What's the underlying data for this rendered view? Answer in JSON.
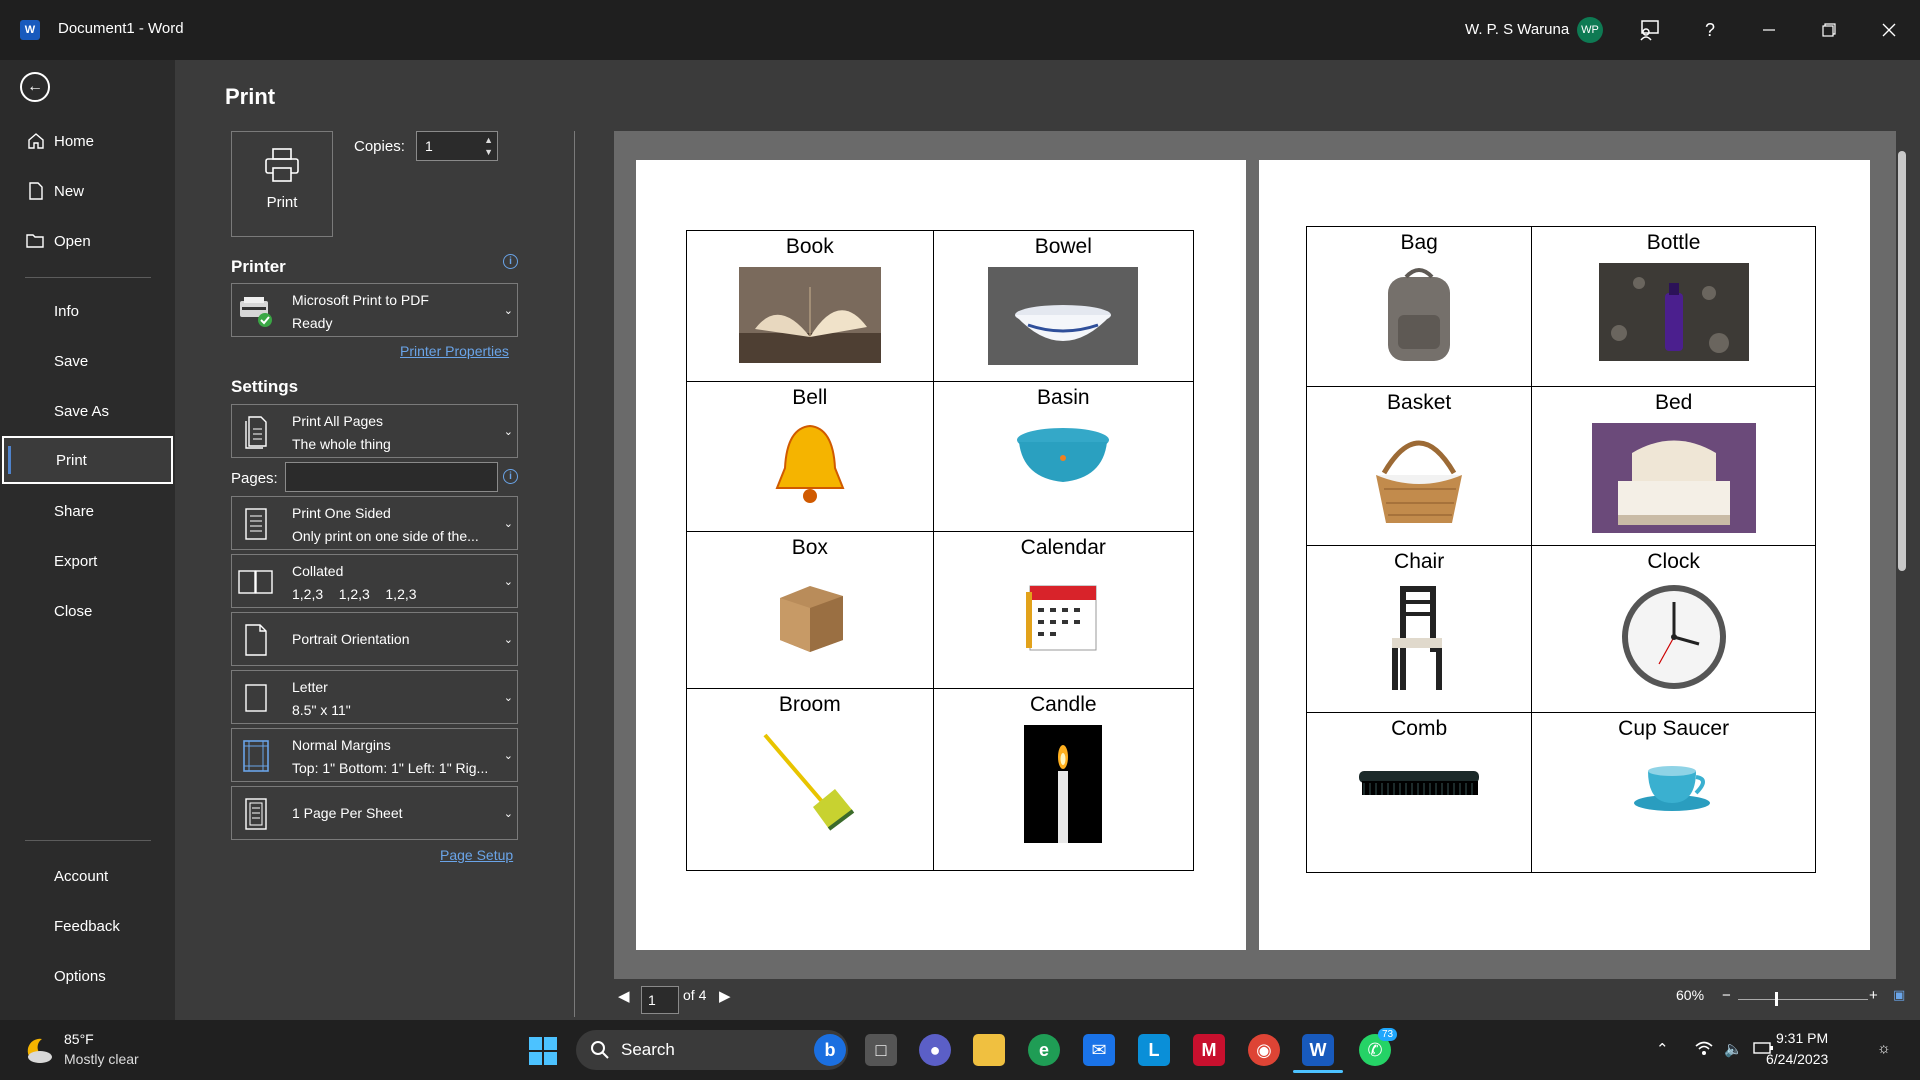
{
  "titlebar": {
    "app_icon": "word-icon",
    "document_title": "Document1  -  Word",
    "user_name": "W. P. S Waruna",
    "user_initials": "WP"
  },
  "nav": {
    "items": [
      {
        "label": "Home",
        "icon": "home-icon"
      },
      {
        "label": "New",
        "icon": "new-document-icon"
      },
      {
        "label": "Open",
        "icon": "open-folder-icon"
      },
      {
        "label": "Info"
      },
      {
        "label": "Save"
      },
      {
        "label": "Save As"
      },
      {
        "label": "Print",
        "selected": true
      },
      {
        "label": "Share"
      },
      {
        "label": "Export"
      },
      {
        "label": "Close"
      }
    ],
    "bottom_items": [
      {
        "label": "Account"
      },
      {
        "label": "Feedback"
      },
      {
        "label": "Options"
      }
    ]
  },
  "print": {
    "heading": "Print",
    "button_label": "Print",
    "copies_label": "Copies:",
    "copies_value": "1",
    "printer_heading": "Printer",
    "printer_name": "Microsoft Print to PDF",
    "printer_status": "Ready",
    "printer_properties": "Printer Properties",
    "settings_heading": "Settings",
    "pages_label": "Pages:",
    "pages_value": "",
    "settings": [
      {
        "line1": "Print All Pages",
        "line2": "The whole thing",
        "icon": "pages-icon"
      },
      {
        "line1": "Print One Sided",
        "line2": "Only print on one side of the...",
        "icon": "one-sided-icon"
      },
      {
        "line1": "Collated",
        "line2": "1,2,3    1,2,3    1,2,3",
        "icon": "collated-icon"
      },
      {
        "line1": "Portrait Orientation",
        "line2": "",
        "icon": "portrait-icon"
      },
      {
        "line1": "Letter",
        "line2": "8.5\" x 11\"",
        "icon": "paper-size-icon"
      },
      {
        "line1": "Normal Margins",
        "line2": "Top: 1\" Bottom: 1\" Left: 1\" Rig...",
        "icon": "margins-icon"
      },
      {
        "line1": "1 Page Per Sheet",
        "line2": "",
        "icon": "pages-per-sheet-icon"
      }
    ],
    "page_setup": "Page Setup"
  },
  "preview": {
    "page1": [
      [
        "Book",
        "Bowel"
      ],
      [
        "Bell",
        "Basin"
      ],
      [
        "Box",
        "Calendar"
      ],
      [
        "Broom",
        "Candle"
      ]
    ],
    "page2": [
      [
        "Bag",
        "Bottle"
      ],
      [
        "Basket",
        "Bed"
      ],
      [
        "Chair",
        "Clock"
      ],
      [
        "Comb",
        "Cup Saucer"
      ]
    ],
    "current_page": "1",
    "total_pages": "of 4",
    "zoom": "60%"
  },
  "taskbar": {
    "weather_temp": "85°F",
    "weather_desc": "Mostly clear",
    "search_placeholder": "Search",
    "whatsapp_badge": "73",
    "time": "9:31 PM",
    "date": "6/24/2023"
  }
}
